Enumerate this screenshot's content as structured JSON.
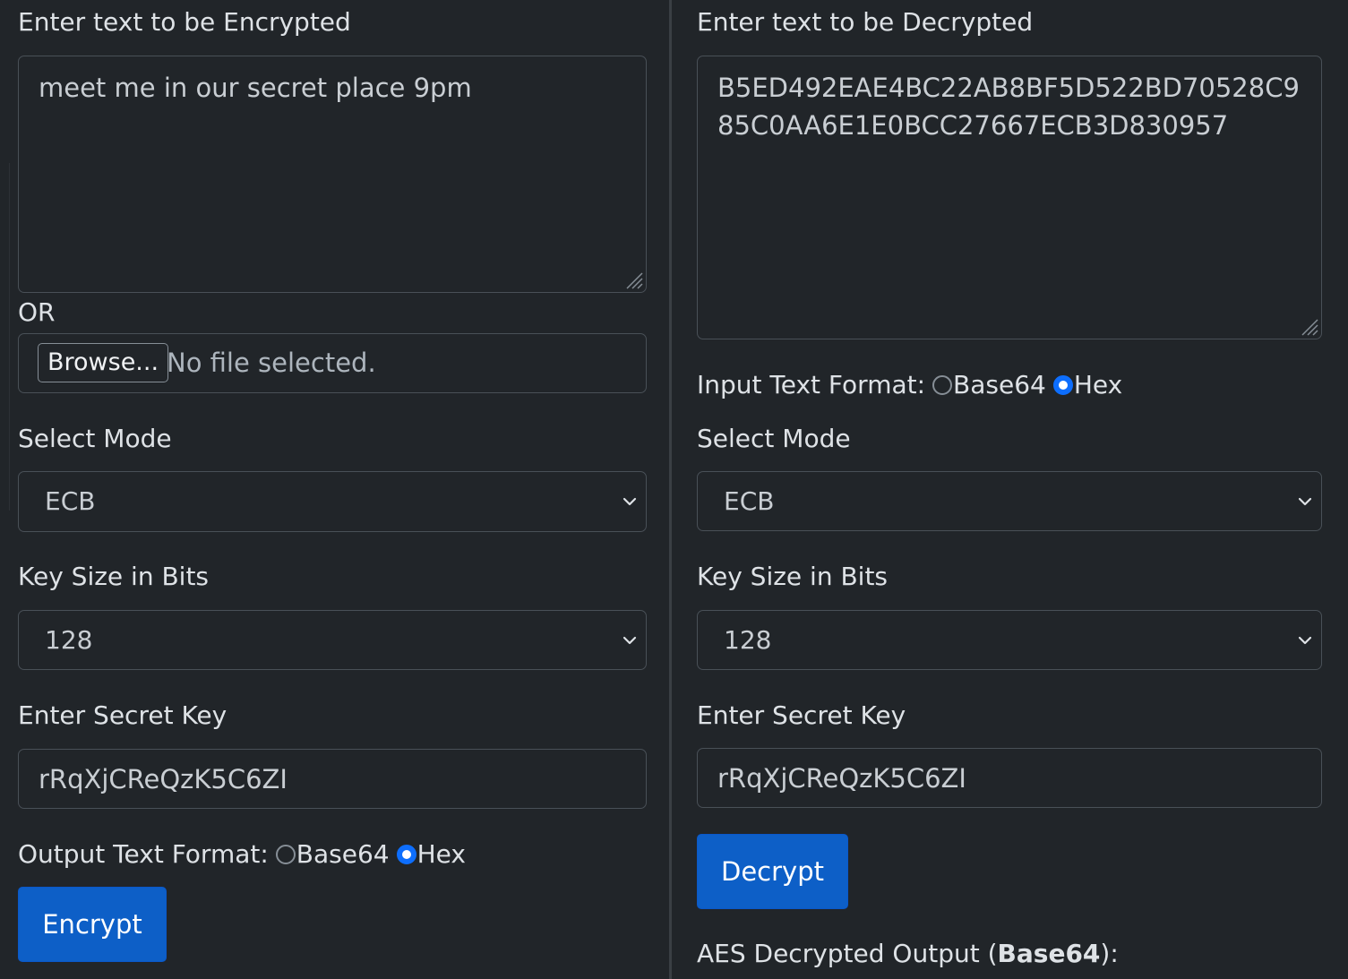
{
  "encrypt": {
    "heading": "Enter text to be Encrypted",
    "textarea_value": "meet me in our secret place 9pm",
    "or_label": "OR",
    "browse_label": "Browse...",
    "file_status": "No file selected.",
    "mode_label": "Select Mode",
    "mode_value": "ECB",
    "key_size_label": "Key Size in Bits",
    "key_size_value": "128",
    "secret_key_label": "Enter Secret Key",
    "secret_key_value": "rRqXjCReQzK5C6ZI",
    "output_format_label": "Output Text Format:",
    "format_options": [
      "Base64",
      "Hex"
    ],
    "format_selected": "Hex",
    "button_label": "Encrypt"
  },
  "decrypt": {
    "heading": "Enter text to be Decrypted",
    "textarea_value": "B5ED492EAE4BC22AB8BF5D522BD70528C985C0AA6E1E0BCC27667ECB3D830957",
    "input_format_label": "Input Text Format:",
    "format_options": [
      "Base64",
      "Hex"
    ],
    "format_selected": "Hex",
    "mode_label": "Select Mode",
    "mode_value": "ECB",
    "key_size_label": "Key Size in Bits",
    "key_size_value": "128",
    "secret_key_label": "Enter Secret Key",
    "secret_key_value": "rRqXjCReQzK5C6ZI",
    "button_label": "Decrypt",
    "output_label": "AES Decrypted Output",
    "output_format_open": "(",
    "output_format_bold": "Base64",
    "output_format_close": "):"
  },
  "colors": {
    "background": "#212529",
    "primary": "#0d5fc7",
    "radio_checked": "#0d6efd",
    "border": "#495057"
  }
}
